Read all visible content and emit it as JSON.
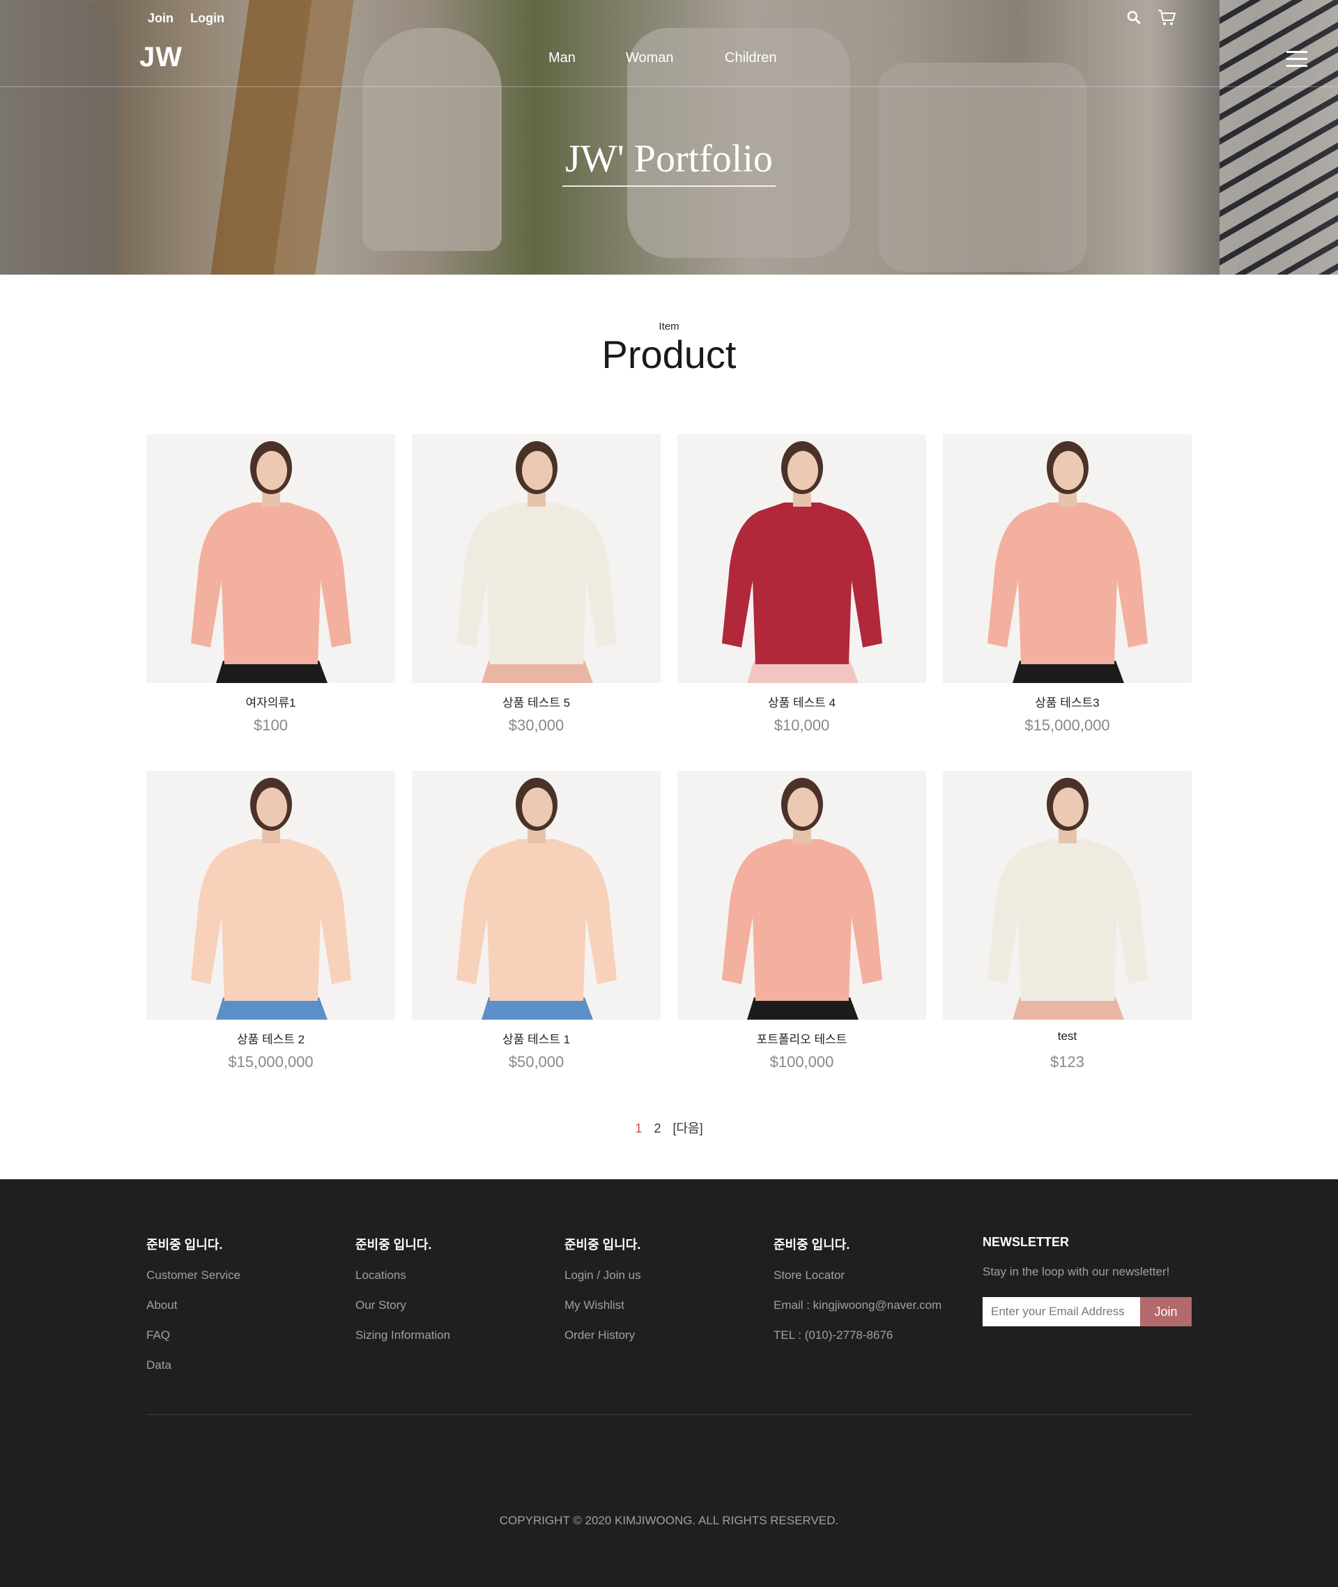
{
  "header": {
    "join_label": "Join",
    "login_label": "Login",
    "logo": "JW",
    "nav": [
      "Man",
      "Woman",
      "Children"
    ],
    "hero_title": "JW' Portfolio"
  },
  "section": {
    "kicker": "Item",
    "title": "Product"
  },
  "products": [
    {
      "name": "여자의류1",
      "price": "$100",
      "shirt": "#f3b09e",
      "bottom": "#1b1b1b"
    },
    {
      "name": "상품 테스트 5",
      "price": "$30,000",
      "shirt": "#efebe1",
      "bottom": "#eab6a4"
    },
    {
      "name": "상품 테스트 4",
      "price": "$10,000",
      "shirt": "#b0283a",
      "bottom": "#f0c6c3"
    },
    {
      "name": "상품 테스트3",
      "price": "$15,000,000",
      "shirt": "#f3b09e",
      "bottom": "#1b1b1b"
    },
    {
      "name": "상품 테스트 2",
      "price": "$15,000,000",
      "shirt": "#f8d1bb",
      "bottom": "#5c8fc7"
    },
    {
      "name": "상품 테스트 1",
      "price": "$50,000",
      "shirt": "#f8d1bb",
      "bottom": "#5c8fc7"
    },
    {
      "name": "포트폴리오 테스트",
      "price": "$100,000",
      "shirt": "#f3b09e",
      "bottom": "#1b1b1b"
    },
    {
      "name": "test",
      "price": "$123",
      "shirt": "#efebe1",
      "bottom": "#eab6a4"
    }
  ],
  "pagination": {
    "pages": [
      "1",
      "2"
    ],
    "current": "1",
    "next_label": "[다음]"
  },
  "footer": {
    "columns": [
      {
        "heading": "준비중 입니다.",
        "links": [
          "Customer Service",
          "About",
          "FAQ",
          "Data"
        ]
      },
      {
        "heading": "준비중 입니다.",
        "links": [
          "Locations",
          "Our Story",
          "Sizing Information"
        ]
      },
      {
        "heading": "준비중 입니다.",
        "links": [
          "Login / Join us",
          "My Wishlist",
          "Order History"
        ]
      },
      {
        "heading": "준비중 입니다.",
        "links": [
          "Store Locator",
          "Email : kingjiwoong@naver.com",
          "TEL : (010)-2778-8676"
        ]
      }
    ],
    "newsletter": {
      "heading": "NEWSLETTER",
      "text": "Stay in the loop with our newsletter!",
      "placeholder": "Enter your Email Address",
      "button_label": "Join"
    },
    "copyright": "COPYRIGHT © 2020 KIMJIWOONG. ALL RIGHTS RESERVED."
  },
  "colors": {
    "accent": "#b46a6a",
    "active_page": "#d04a4a",
    "footer_bg": "#1f1f1f"
  },
  "icons": [
    "search-icon",
    "cart-icon",
    "hamburger-menu-icon"
  ]
}
